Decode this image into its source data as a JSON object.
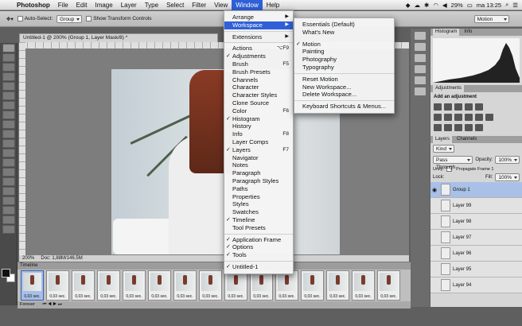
{
  "menubar": {
    "app": "Photoshop",
    "items": [
      "File",
      "Edit",
      "Image",
      "Layer",
      "Type",
      "Select",
      "Filter",
      "View",
      "Window",
      "Help"
    ],
    "active": "Window",
    "battery": "29%",
    "clock": "ma 13:25"
  },
  "options": {
    "auto_select_label": "Auto-Select:",
    "auto_select_value": "Group",
    "show_transform_label": "Show Transform Controls",
    "workspace_select": "Motion"
  },
  "document": {
    "tab_title": "Untitled-1 @ 200% (Group 1, Layer Mask/8) *",
    "zoom": "200%",
    "doc_size": "Doc: 1,88M/146,5M"
  },
  "timeline": {
    "title": "Timeline",
    "frame_delay": "0,03 sec.",
    "loop": "Forever"
  },
  "panels": {
    "histogram_tabs": [
      "Histogram",
      "Info"
    ],
    "adjustments_title": "Adjustments",
    "adjustments_hint": "Add an adjustment",
    "layers_tabs": [
      "Layers",
      "Channels"
    ],
    "kind_filter": "Kind",
    "blend_mode": "Pass Through",
    "opacity_label": "Opacity:",
    "opacity": "100%",
    "unify_label": "Unify:",
    "propagate_label": "Propagate Frame 1",
    "lock_label": "Lock:",
    "fill_label": "Fill:",
    "fill": "100%",
    "layers": [
      "Group 1",
      "Layer 99",
      "Layer 98",
      "Layer 97",
      "Layer 96",
      "Layer 95",
      "Layer 94"
    ]
  },
  "window_menu": {
    "items": [
      {
        "label": "Arrange",
        "submenu": true
      },
      {
        "label": "Workspace",
        "submenu": true,
        "highlight": true
      },
      {
        "sep": true
      },
      {
        "label": "Extensions",
        "submenu": true
      },
      {
        "sep": true
      },
      {
        "label": "Actions",
        "shortcut": "⌥F9"
      },
      {
        "label": "Adjustments",
        "checked": true
      },
      {
        "label": "Brush",
        "shortcut": "F5"
      },
      {
        "label": "Brush Presets"
      },
      {
        "label": "Channels"
      },
      {
        "label": "Character"
      },
      {
        "label": "Character Styles"
      },
      {
        "label": "Clone Source"
      },
      {
        "label": "Color",
        "shortcut": "F6"
      },
      {
        "label": "Histogram",
        "checked": true
      },
      {
        "label": "History"
      },
      {
        "label": "Info",
        "shortcut": "F8"
      },
      {
        "label": "Layer Comps"
      },
      {
        "label": "Layers",
        "checked": true,
        "shortcut": "F7"
      },
      {
        "label": "Navigator"
      },
      {
        "label": "Notes"
      },
      {
        "label": "Paragraph"
      },
      {
        "label": "Paragraph Styles"
      },
      {
        "label": "Paths"
      },
      {
        "label": "Properties"
      },
      {
        "label": "Styles"
      },
      {
        "label": "Swatches"
      },
      {
        "label": "Timeline",
        "checked": true
      },
      {
        "label": "Tool Presets"
      },
      {
        "sep": true
      },
      {
        "label": "Application Frame",
        "checked": true
      },
      {
        "label": "Options",
        "checked": true
      },
      {
        "label": "Tools",
        "checked": true
      },
      {
        "sep": true
      },
      {
        "label": "Untitled-1",
        "checked": true
      }
    ]
  },
  "workspace_menu": {
    "items": [
      {
        "label": "Essentials (Default)"
      },
      {
        "label": "What's New"
      },
      {
        "gap": true
      },
      {
        "label": "Motion",
        "checked": true
      },
      {
        "label": "Painting"
      },
      {
        "label": "Photography"
      },
      {
        "label": "Typography"
      },
      {
        "sep": true
      },
      {
        "label": "Reset Motion"
      },
      {
        "label": "New Workspace..."
      },
      {
        "label": "Delete Workspace..."
      },
      {
        "sep": true
      },
      {
        "label": "Keyboard Shortcuts & Menus..."
      }
    ]
  }
}
